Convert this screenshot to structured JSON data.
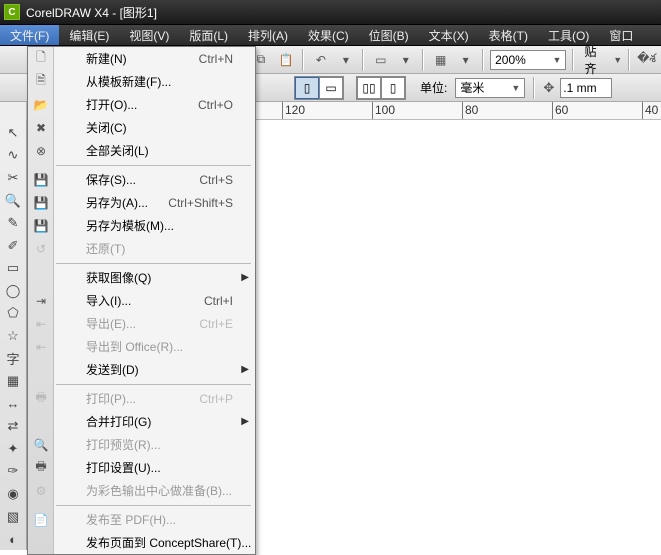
{
  "titlebar": {
    "title": "CorelDRAW X4 - [图形1]"
  },
  "menubar": {
    "items": [
      {
        "label": "文件(F)"
      },
      {
        "label": "编辑(E)"
      },
      {
        "label": "视图(V)"
      },
      {
        "label": "版面(L)"
      },
      {
        "label": "排列(A)"
      },
      {
        "label": "效果(C)"
      },
      {
        "label": "位图(B)"
      },
      {
        "label": "文本(X)"
      },
      {
        "label": "表格(T)"
      },
      {
        "label": "工具(O)"
      },
      {
        "label": "窗口"
      }
    ]
  },
  "toolbar": {
    "zoom": "200%",
    "snap": "贴齐",
    "units_label": "单位:",
    "units_value": "毫米",
    "nudge_value": ".1 mm"
  },
  "ruler": {
    "ticks": [
      {
        "pos": 255,
        "label": "120"
      },
      {
        "pos": 345,
        "label": "100"
      },
      {
        "pos": 435,
        "label": "80"
      },
      {
        "pos": 525,
        "label": "60"
      },
      {
        "pos": 615,
        "label": "40"
      }
    ]
  },
  "file_menu": [
    {
      "label": "新建(N)",
      "shortcut": "Ctrl+N",
      "icon": "new",
      "disabled": false
    },
    {
      "label": "从模板新建(F)...",
      "shortcut": "",
      "icon": "template",
      "disabled": false
    },
    {
      "label": "打开(O)...",
      "shortcut": "Ctrl+O",
      "icon": "open",
      "disabled": false
    },
    {
      "label": "关闭(C)",
      "shortcut": "",
      "icon": "close",
      "disabled": false
    },
    {
      "label": "全部关闭(L)",
      "shortcut": "",
      "icon": "closeall",
      "disabled": false
    },
    {
      "sep": true
    },
    {
      "label": "保存(S)...",
      "shortcut": "Ctrl+S",
      "icon": "save",
      "disabled": false
    },
    {
      "label": "另存为(A)...",
      "shortcut": "Ctrl+Shift+S",
      "icon": "saveas",
      "disabled": false
    },
    {
      "label": "另存为模板(M)...",
      "shortcut": "",
      "icon": "savetpl",
      "disabled": false
    },
    {
      "label": "还原(T)",
      "shortcut": "",
      "icon": "revert",
      "disabled": true
    },
    {
      "sep": true
    },
    {
      "label": "获取图像(Q)",
      "shortcut": "",
      "icon": "",
      "disabled": false,
      "submenu": true
    },
    {
      "label": "导入(I)...",
      "shortcut": "Ctrl+I",
      "icon": "import",
      "disabled": false
    },
    {
      "label": "导出(E)...",
      "shortcut": "Ctrl+E",
      "icon": "export",
      "disabled": true
    },
    {
      "label": "导出到 Office(R)...",
      "shortcut": "",
      "icon": "exportoff",
      "disabled": true
    },
    {
      "label": "发送到(D)",
      "shortcut": "",
      "icon": "",
      "disabled": false,
      "submenu": true
    },
    {
      "sep": true
    },
    {
      "label": "打印(P)...",
      "shortcut": "Ctrl+P",
      "icon": "print",
      "disabled": true
    },
    {
      "label": "合并打印(G)",
      "shortcut": "",
      "icon": "",
      "disabled": false,
      "submenu": true
    },
    {
      "label": "打印预览(R)...",
      "shortcut": "",
      "icon": "preview",
      "disabled": true
    },
    {
      "label": "打印设置(U)...",
      "shortcut": "",
      "icon": "printset",
      "disabled": false
    },
    {
      "label": "为彩色输出中心做准备(B)...",
      "shortcut": "",
      "icon": "prepress",
      "disabled": true
    },
    {
      "sep": true
    },
    {
      "label": "发布至 PDF(H)...",
      "shortcut": "",
      "icon": "pdf",
      "disabled": true
    },
    {
      "label": "发布页面到 ConceptShare(T)...",
      "shortcut": "",
      "icon": "",
      "disabled": false
    }
  ],
  "toolbox_icons": [
    "pick",
    "shape",
    "crop",
    "zoom",
    "freehand",
    "smart",
    "rect",
    "ellipse",
    "polygon",
    "shapes",
    "text",
    "table",
    "dimension",
    "connector",
    "effects",
    "eyedrop",
    "outline",
    "fill",
    "interactive"
  ]
}
